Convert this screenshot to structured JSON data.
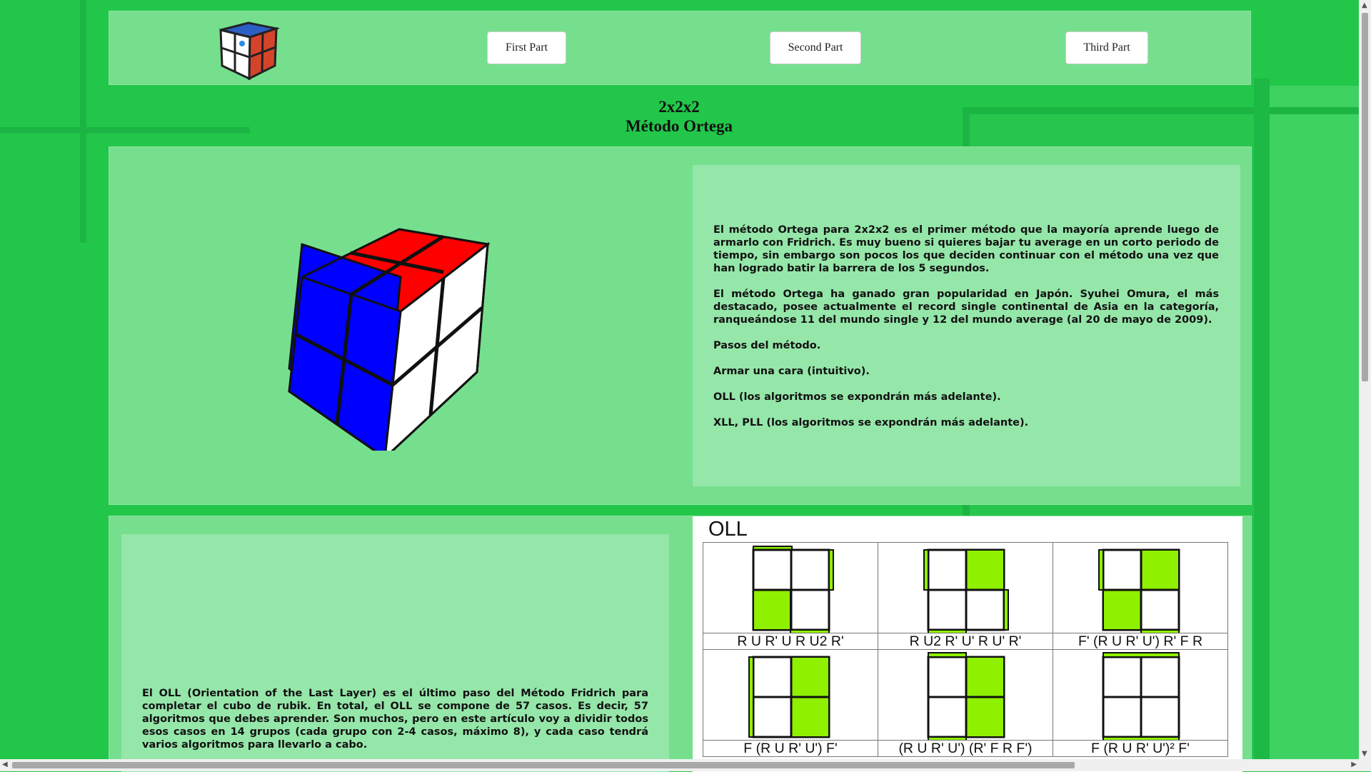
{
  "nav": {
    "first_part": "First Part",
    "second_part": "Second Part",
    "third_part": "Third Part"
  },
  "page_title": {
    "line1": "2x2x2",
    "line2": "Método Ortega"
  },
  "intro": {
    "p1": "El método Ortega para 2x2x2 es el primer método que la mayoría aprende luego de armarlo con Fridrich. Es muy bueno si quieres bajar tu average en un corto periodo de tiempo, sin embargo son pocos los que deciden continuar con el método una vez que han logrado batir la barrera de los 5 segundos.",
    "p2": "El método Ortega ha ganado gran popularidad en Japón. Syuhei Omura, el más destacado, posee actualmente el record single continental de Asia en la categoría, ranqueándose 11 del mundo single y 12 del mundo average (al 20 de mayo de 2009).",
    "p3": "Pasos del método.",
    "p4": "Armar una cara (intuitivo).",
    "p5": "OLL (los algoritmos se expondrán más adelante).",
    "p6": "XLL, PLL (los algoritmos se expondrán más adelante)."
  },
  "oll_text": "El OLL (Orientation of the Last Layer) es el último paso del Método Fridrich para completar el cubo de rubik. En total, el OLL se compone de 57 casos. Es decir, 57 algoritmos que debes aprender. Son muchos, pero en este artículo voy a dividir todos esos casos en 14 grupos (cada grupo con 2-4 casos, máximo 8), y cada caso tendrá varios algoritmos para llevarlo a cabo.",
  "oll_image": {
    "title": "OLL",
    "algs": [
      "R U R' U R U2 R'",
      "R U2 R' U' R U' R'",
      "F' (R U R' U') R' F R",
      "F (R U R' U') F'",
      "(R U R' U') (R' F R F')",
      "F (R U R' U')² F'"
    ]
  },
  "colors": {
    "accent": "#22c74a",
    "panel": "#76df8e",
    "sticker_green": "#8ff000"
  }
}
